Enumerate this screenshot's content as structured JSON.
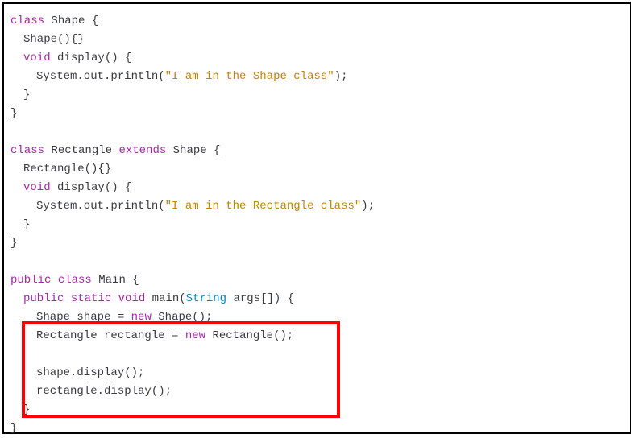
{
  "code": {
    "l1_class": "class",
    "l1_name": "Shape",
    "l1_brace": " {",
    "l2": "Shape(){}",
    "l3_void": "void",
    "l3_method": " display() {",
    "l4_pre": "System.out.println(",
    "l4_str": "\"I am in the Shape class\"",
    "l4_post": ");",
    "l5": "}",
    "l6": "}",
    "l7_class": "class",
    "l7_name": " Rectangle ",
    "l7_extends": "extends",
    "l7_super": " Shape {",
    "l8": "Rectangle(){}",
    "l9_void": "void",
    "l9_method": " display() {",
    "l10_pre": "System.out.println(",
    "l10_str": "\"I am in the Rectangle class\"",
    "l10_post": ");",
    "l11": "}",
    "l12": "}",
    "l13_public": "public",
    "l13_class": " class",
    "l13_name": " Main {",
    "l14_public": "public",
    "l14_static": " static",
    "l14_void": " void",
    "l14_main": " main(",
    "l14_type": "String",
    "l14_args": " args[]) {",
    "l15_type1": "Shape",
    "l15_var": " shape = ",
    "l15_new": "new",
    "l15_ctor": " Shape();",
    "l16_type1": "Rectangle",
    "l16_var": " rectangle = ",
    "l16_new": "new",
    "l16_ctor": " Rectangle();",
    "l17": "shape.display();",
    "l18": "rectangle.display();",
    "l19": "}",
    "l20": "}"
  }
}
